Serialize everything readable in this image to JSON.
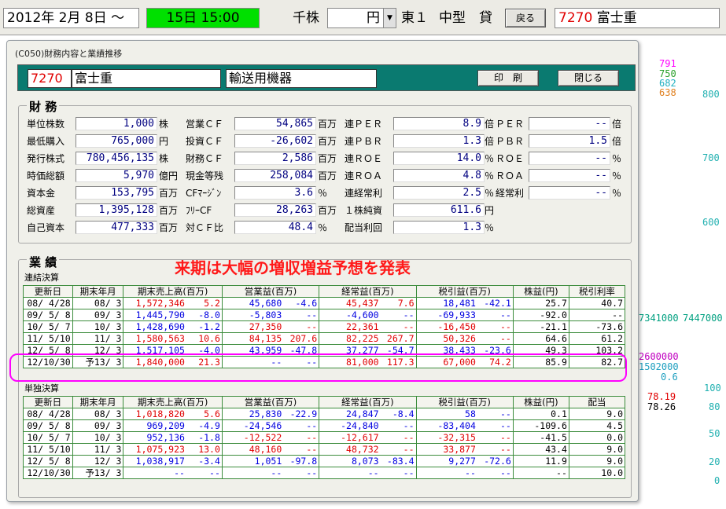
{
  "topbar": {
    "date": "2012年 2月 8日 ～",
    "end_date": "15日 15:00",
    "unit": "千株",
    "currency": "円",
    "market": "東１",
    "size": "中型",
    "lend": "貸",
    "back_btn": "戻る",
    "code": "7270",
    "name": "富士重"
  },
  "side": {
    "p791": "791",
    "p750": "750",
    "p682": "682",
    "p638": "638",
    "a800": "800",
    "a700": "700",
    "a600": "600",
    "v1": "7341000",
    "v2": "7447000",
    "v3": "2600000",
    "v4": "1502000",
    "v5": "0.6",
    "a100": "100",
    "a80": "80",
    "m1": "78.19",
    "m2": "78.26",
    "a50": "50",
    "a20": "20",
    "a0": "0"
  },
  "colors": {
    "title_bar": "#0a7a70",
    "highlight": "#ff00ff",
    "note": "#ff1a1a",
    "positive": "#e00000",
    "negative": "#0000e0"
  },
  "dialog": {
    "title": "(C050)財務内容と業績推移",
    "code": "7270",
    "name": "富士重",
    "sector": "輸送用機器",
    "print_btn": "印　刷",
    "close_btn": "閉じる"
  },
  "finance": {
    "title": "財 務",
    "col1": [
      {
        "label": "単位株数",
        "value": "1,000",
        "unit": "株"
      },
      {
        "label": "最低購入",
        "value": "765,000",
        "unit": "円"
      },
      {
        "label": "発行株式",
        "value": "780,456,135",
        "unit": "株"
      },
      {
        "label": "時価総額",
        "value": "5,970",
        "unit": "億円"
      },
      {
        "label": "資本金",
        "value": "153,795",
        "unit": "百万"
      },
      {
        "label": "総資産",
        "value": "1,395,128",
        "unit": "百万"
      },
      {
        "label": "自己資本",
        "value": "477,333",
        "unit": "百万"
      }
    ],
    "col2": [
      {
        "label": "営業ＣＦ",
        "value": "54,865",
        "unit": "百万"
      },
      {
        "label": "投資ＣＦ",
        "value": "-26,602",
        "unit": "百万"
      },
      {
        "label": "財務ＣＦ",
        "value": "2,586",
        "unit": "百万"
      },
      {
        "label": "現金等残",
        "value": "258,084",
        "unit": "百万"
      },
      {
        "label": "CFﾏｰｼﾞﾝ",
        "value": "3.6",
        "unit": "％"
      },
      {
        "label": "ﾌﾘｰCF",
        "value": "28,263",
        "unit": "百万"
      },
      {
        "label": "対ＣＦ比",
        "value": "48.4",
        "unit": "％"
      }
    ],
    "col3": [
      {
        "label": "連ＰＥＲ",
        "value": "8.9",
        "unit": "倍"
      },
      {
        "label": "連ＰＢＲ",
        "value": "1.3",
        "unit": "倍"
      },
      {
        "label": "連ＲＯＥ",
        "value": "14.0",
        "unit": "％"
      },
      {
        "label": "連ＲＯＡ",
        "value": "4.8",
        "unit": "％"
      },
      {
        "label": "連経常利",
        "value": "2.5",
        "unit": "％"
      },
      {
        "label": "１株純資",
        "value": "611.6",
        "unit": "円"
      },
      {
        "label": "配当利回",
        "value": "1.3",
        "unit": "％"
      }
    ],
    "col4": [
      {
        "label": "ＰＥＲ",
        "value": "--",
        "unit": "倍"
      },
      {
        "label": "ＰＢＲ",
        "value": "1.5",
        "unit": "倍"
      },
      {
        "label": "ＲＯＥ",
        "value": "--",
        "unit": "％"
      },
      {
        "label": "ＲＯＡ",
        "value": "--",
        "unit": "％"
      },
      {
        "label": "経常利",
        "value": "--",
        "unit": "％"
      }
    ]
  },
  "results": {
    "title": "業 績",
    "note": "来期は大幅の増収増益予想を発表",
    "consolidated_label": "連結決算",
    "single_label": "単独決算",
    "headers": [
      "更新日",
      "期末年月",
      "期末売上高(百万)",
      "営業益(百万)",
      "経常益(百万)",
      "税引益(百万)",
      "株益(円)",
      "税引利率"
    ],
    "single_headers": [
      "更新日",
      "期末年月",
      "期末売上高(百万)",
      "営業益(百万)",
      "経常益(百万)",
      "税引益(百万)",
      "株益(円)",
      "配当"
    ],
    "consolidated": [
      {
        "date": "08/ 4/28",
        "period": "08/ 3",
        "sales": "1,572,346",
        "sales_g": "5.2",
        "op": "45,680",
        "op_g": "-4.6",
        "ord": "45,437",
        "ord_g": "7.6",
        "net": "18,481",
        "net_g": "-42.1",
        "eps": "25.7",
        "rate": "40.7",
        "c": [
          "r",
          "b",
          "r",
          "b",
          "k",
          "k"
        ]
      },
      {
        "date": "09/ 5/ 8",
        "period": "09/ 3",
        "sales": "1,445,790",
        "sales_g": "-8.0",
        "op": "-5,803",
        "op_g": "--",
        "ord": "-4,600",
        "ord_g": "--",
        "net": "-69,933",
        "net_g": "--",
        "eps": "-92.0",
        "rate": "--",
        "c": [
          "b",
          "b",
          "b",
          "b",
          "k",
          "k"
        ]
      },
      {
        "date": "10/ 5/ 7",
        "period": "10/ 3",
        "sales": "1,428,690",
        "sales_g": "-1.2",
        "op": "27,350",
        "op_g": "--",
        "ord": "22,361",
        "ord_g": "--",
        "net": "-16,450",
        "net_g": "--",
        "eps": "-21.1",
        "rate": "-73.6",
        "c": [
          "b",
          "r",
          "r",
          "r",
          "k",
          "k"
        ]
      },
      {
        "date": "11/ 5/10",
        "period": "11/ 3",
        "sales": "1,580,563",
        "sales_g": "10.6",
        "op": "84,135",
        "op_g": "207.6",
        "ord": "82,225",
        "ord_g": "267.7",
        "net": "50,326",
        "net_g": "--",
        "eps": "64.6",
        "rate": "61.2",
        "c": [
          "r",
          "r",
          "r",
          "r",
          "k",
          "k"
        ]
      },
      {
        "date": "12/ 5/ 8",
        "period": "12/ 3",
        "sales": "1,517,105",
        "sales_g": "-4.0",
        "op": "43,959",
        "op_g": "-47.8",
        "ord": "37,277",
        "ord_g": "-54.7",
        "net": "38,433",
        "net_g": "-23.6",
        "eps": "49.3",
        "rate": "103.2",
        "c": [
          "b",
          "b",
          "b",
          "b",
          "k",
          "k"
        ]
      },
      {
        "date": "12/10/30",
        "period": "予13/ 3",
        "sales": "1,840,000",
        "sales_g": "21.3",
        "op": "--",
        "op_g": "--",
        "ord": "81,000",
        "ord_g": "117.3",
        "net": "67,000",
        "net_g": "74.2",
        "eps": "85.9",
        "rate": "82.7",
        "c": [
          "r",
          "b",
          "r",
          "r",
          "k",
          "k"
        ]
      }
    ],
    "single": [
      {
        "date": "08/ 4/28",
        "period": "08/ 3",
        "sales": "1,018,820",
        "sales_g": "5.6",
        "op": "25,830",
        "op_g": "-22.9",
        "ord": "24,847",
        "ord_g": "-8.4",
        "net": "58",
        "net_g": "--",
        "eps": "0.1",
        "rate": "9.0",
        "c": [
          "r",
          "b",
          "b",
          "b",
          "k",
          "k"
        ]
      },
      {
        "date": "09/ 5/ 8",
        "period": "09/ 3",
        "sales": "969,209",
        "sales_g": "-4.9",
        "op": "-24,546",
        "op_g": "--",
        "ord": "-24,840",
        "ord_g": "--",
        "net": "-83,404",
        "net_g": "--",
        "eps": "-109.6",
        "rate": "4.5",
        "c": [
          "b",
          "b",
          "b",
          "b",
          "k",
          "k"
        ]
      },
      {
        "date": "10/ 5/ 7",
        "period": "10/ 3",
        "sales": "952,136",
        "sales_g": "-1.8",
        "op": "-12,522",
        "op_g": "--",
        "ord": "-12,617",
        "ord_g": "--",
        "net": "-32,315",
        "net_g": "--",
        "eps": "-41.5",
        "rate": "0.0",
        "c": [
          "b",
          "r",
          "r",
          "r",
          "k",
          "k"
        ]
      },
      {
        "date": "11/ 5/10",
        "period": "11/ 3",
        "sales": "1,075,923",
        "sales_g": "13.0",
        "op": "48,160",
        "op_g": "--",
        "ord": "48,732",
        "ord_g": "--",
        "net": "33,877",
        "net_g": "--",
        "eps": "43.4",
        "rate": "9.0",
        "c": [
          "r",
          "r",
          "r",
          "r",
          "k",
          "k"
        ]
      },
      {
        "date": "12/ 5/ 8",
        "period": "12/ 3",
        "sales": "1,038,917",
        "sales_g": "-3.4",
        "op": "1,051",
        "op_g": "-97.8",
        "ord": "8,073",
        "ord_g": "-83.4",
        "net": "9,277",
        "net_g": "-72.6",
        "eps": "11.9",
        "rate": "9.0",
        "c": [
          "b",
          "b",
          "b",
          "b",
          "k",
          "k"
        ]
      },
      {
        "date": "12/10/30",
        "period": "予13/ 3",
        "sales": "--",
        "sales_g": "--",
        "op": "--",
        "op_g": "--",
        "ord": "--",
        "ord_g": "--",
        "net": "--",
        "net_g": "--",
        "eps": "--",
        "rate": "10.0",
        "c": [
          "b",
          "b",
          "b",
          "b",
          "k",
          "k"
        ]
      }
    ]
  }
}
